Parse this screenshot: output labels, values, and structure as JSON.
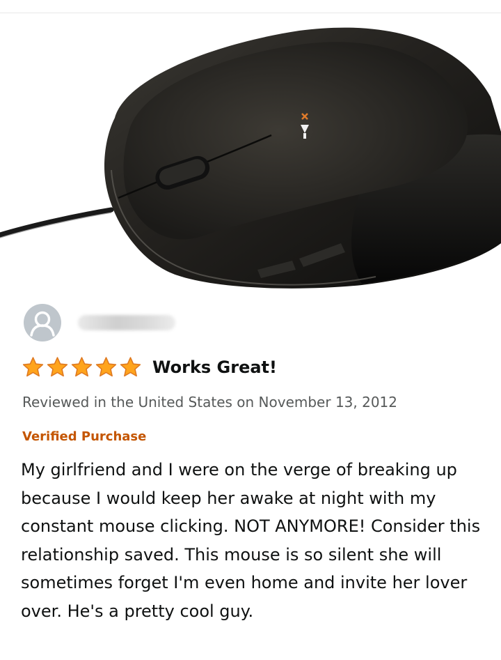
{
  "review": {
    "star_rating": 5,
    "star_max": 5,
    "title": "Works Great!",
    "meta": "Reviewed in the United States on November 13, 2012",
    "verified_label": "Verified Purchase",
    "body": "My girlfriend and I were on the verge of breaking up because I would keep her awake at night with my constant mouse clicking. NOT ANYMORE! Consider this relationship saved. This mouse is so silent she will sometimes forget I'm even home and invite her lover over. He's a pretty cool guy."
  },
  "colors": {
    "star": "#ffa41c",
    "star_outline": "#de7921",
    "verified": "#c45500",
    "meta_text": "#565959",
    "avatar_bg": "#bfc6cc"
  },
  "icons": {
    "avatar": "user-avatar-icon",
    "star": "star-icon"
  }
}
